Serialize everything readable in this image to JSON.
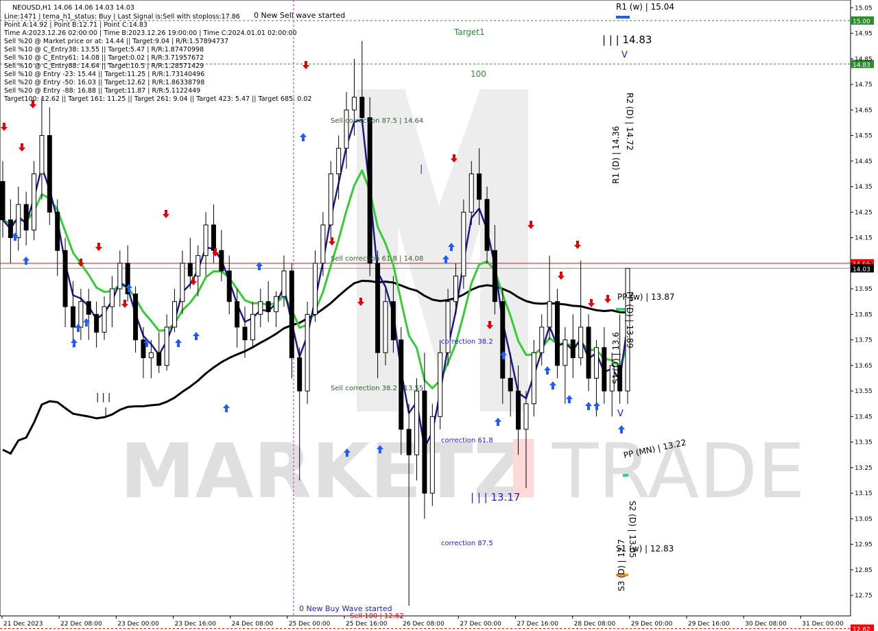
{
  "symbol_line": "NEOUSD,H1  14.06 14.06 14.03 14.03",
  "info_lines": [
    "Line:1471 | tema_h1_status: Buy | Last Signal is:Sell with stoploss:17.86",
    "Point A:14.92 | Point B:12.71 | Point C:14.83",
    "Time A:2023.12.26 02:00:00 | Time B:2023.12.26 19:00:00 | Time C:2024.01.01 02:00:00",
    "Sell %20 @ Market price or at: 14.44 || Target:9.04 | R/R:1.57894737",
    "Sell %10 @ C_Entry38: 13.55 || Target:5.47 | R/R:1.87470998",
    "Sell %10 @ C_Entry61: 14.08 || Target:0.02 | R/R:3.71957672",
    "Sell %10 @ C_Entry88: 14.64 || Target:10.5 | R/R:1.28571429",
    "Sell %10 @ Entry -23: 15.44 || Target:11.25 | R/R:1.73140496",
    "Sell %20 @ Entry -50: 16.03 || Target:12.62 | R/R:1.86338798",
    "Sell %20 @ Entry -88: 16.88 || Target:11.87 | R/R:5.1122449",
    "Target100: 12.62 || Target 161: 11.25 || Target 261: 9.04 || Target 423: 5.47 || Target 685: 0.02"
  ],
  "chart_labels": {
    "new_sell_wave": "0 New Sell wave started",
    "new_buy_wave": "0 New Buy Wave started",
    "target1": "Target1",
    "hundred": "100",
    "sell_corr_875": "Sell correction 87.5 | 14.64",
    "sell_corr_618": "Sell correction 61.8 | 14.08",
    "sell_corr_382": "Sell correction 38.2 | 13.55",
    "corr_382": "correction 38.2",
    "corr_618": "correction 61.8",
    "corr_875": "correction 87.5",
    "wave_1483": "| | | 14.83",
    "wave_1317": "| | | 13.17",
    "sell_100": "Sell 100 | 12.62",
    "r1w": "R1 (w) | 15.04",
    "r2d": "R2 (D) | 14.72",
    "r1d": "R1 (D) | 14.36",
    "ppw": "PP (w) | 13.87",
    "ppd": "PP (D) | 13.89",
    "s1d": "S1 (D) | 13.6",
    "ppmn": "PP (MN) | 13.22",
    "s2d": "S2 (D) | 13.05",
    "s1w": "S1 (w) | 12.83",
    "s3d": "S3 (D) | 12.7",
    "mark_bars": "| | |",
    "mark_bar": "|",
    "mark_v": "V"
  },
  "watermark": {
    "left": "MARKETZ",
    "right": "TRADE"
  },
  "colors": {
    "bullish": "#000000",
    "ma_blue": "#1a1a8c",
    "ma_green": "#33cc33",
    "ma_black": "#000000",
    "buy_arrow": "#1e5cff",
    "sell_arrow": "#e00000",
    "price_line": "#ff0000",
    "level_green": "#2e8b2e",
    "magenta": "#d020c0",
    "axis_bg_red": "#ff0000",
    "axis_bg_green": "#2e8b2e"
  },
  "chart_data": {
    "type": "candlestick",
    "ylim": [
      12.675,
      15.075
    ],
    "y_ticks": [
      "15.05",
      "14.95",
      "14.85",
      "14.75",
      "14.65",
      "14.55",
      "14.45",
      "14.35",
      "14.25",
      "14.15",
      "14.05",
      "13.95",
      "13.85",
      "13.75",
      "13.65",
      "13.55",
      "13.45",
      "13.35",
      "13.25",
      "13.15",
      "13.05",
      "12.95",
      "12.85",
      "12.75"
    ],
    "x_ticks": [
      "21 Dec 2023",
      "22 Dec 08:00",
      "23 Dec 00:00",
      "23 Dec 16:00",
      "24 Dec 08:00",
      "25 Dec 00:00",
      "25 Dec 16:00",
      "26 Dec 08:00",
      "27 Dec 00:00",
      "27 Dec 16:00",
      "28 Dec 08:00",
      "29 Dec 00:00",
      "29 Dec 16:00",
      "30 Dec 08:00",
      "31 Dec 00:00"
    ],
    "current_price": 14.03,
    "current_price_label": "14.03",
    "bid_price": 14.05,
    "bid_price_label": "14.05",
    "levels": [
      {
        "name": "Target1",
        "value": 15.0,
        "label": "15.00",
        "color": "#2e8b2e"
      },
      {
        "name": "100",
        "value": 14.83,
        "label": "14.83",
        "color": "#2e8b2e"
      },
      {
        "name": "Sell 100",
        "value": 12.62,
        "label": "12.62",
        "color": "#ff0000"
      }
    ],
    "pivots": [
      {
        "name": "R1 (w)",
        "value": 15.04,
        "color": "#1e5cff"
      },
      {
        "name": "PP (w)",
        "value": 13.87,
        "color": "#22dd77"
      },
      {
        "name": "PP (MN)",
        "value": 13.22,
        "color": "#22dd77"
      },
      {
        "name": "S1 (w)",
        "value": 12.83,
        "color": "#ff9900"
      }
    ],
    "candles": [
      [
        14.37,
        14.45,
        14.15,
        14.22
      ],
      [
        14.22,
        14.3,
        14.05,
        14.15
      ],
      [
        14.15,
        14.35,
        14.1,
        14.28
      ],
      [
        14.28,
        14.33,
        14.12,
        14.18
      ],
      [
        14.18,
        14.45,
        14.14,
        14.4
      ],
      [
        14.4,
        14.7,
        14.3,
        14.55
      ],
      [
        14.55,
        14.66,
        14.2,
        14.25
      ],
      [
        14.25,
        14.3,
        14.0,
        14.1
      ],
      [
        14.1,
        14.15,
        13.8,
        13.88
      ],
      [
        13.88,
        13.98,
        13.72,
        13.8
      ],
      [
        13.8,
        13.95,
        13.75,
        13.9
      ],
      [
        13.9,
        13.95,
        13.75,
        13.85
      ],
      [
        13.85,
        13.9,
        13.72,
        13.78
      ],
      [
        13.78,
        13.92,
        13.75,
        13.88
      ],
      [
        13.88,
        14.0,
        13.8,
        13.95
      ],
      [
        13.95,
        14.1,
        13.88,
        14.05
      ],
      [
        14.05,
        14.12,
        13.9,
        13.93
      ],
      [
        13.93,
        13.96,
        13.7,
        13.75
      ],
      [
        13.75,
        13.8,
        13.6,
        13.68
      ],
      [
        13.68,
        13.75,
        13.6,
        13.7
      ],
      [
        13.7,
        13.78,
        13.62,
        13.65
      ],
      [
        13.65,
        13.85,
        13.63,
        13.8
      ],
      [
        13.8,
        13.95,
        13.78,
        13.9
      ],
      [
        13.9,
        14.1,
        13.85,
        14.05
      ],
      [
        14.05,
        14.15,
        13.95,
        14.0
      ],
      [
        14.0,
        14.12,
        13.92,
        14.08
      ],
      [
        14.08,
        14.25,
        14.0,
        14.2
      ],
      [
        14.2,
        14.28,
        14.05,
        14.1
      ],
      [
        14.1,
        14.18,
        13.98,
        14.02
      ],
      [
        14.02,
        14.08,
        13.85,
        13.9
      ],
      [
        13.9,
        13.95,
        13.72,
        13.8
      ],
      [
        13.8,
        13.88,
        13.68,
        13.75
      ],
      [
        13.75,
        13.9,
        13.72,
        13.85
      ],
      [
        13.85,
        13.95,
        13.8,
        13.9
      ],
      [
        13.9,
        13.98,
        13.82,
        13.86
      ],
      [
        13.86,
        13.94,
        13.8,
        13.92
      ],
      [
        13.92,
        14.08,
        13.88,
        14.02
      ],
      [
        14.02,
        14.05,
        13.6,
        13.68
      ],
      [
        13.68,
        13.72,
        13.2,
        13.55
      ],
      [
        13.55,
        13.9,
        13.5,
        13.85
      ],
      [
        13.85,
        14.1,
        13.82,
        14.05
      ],
      [
        14.05,
        14.25,
        14.0,
        14.2
      ],
      [
        14.2,
        14.45,
        14.15,
        14.4
      ],
      [
        14.4,
        14.55,
        14.3,
        14.5
      ],
      [
        14.5,
        14.72,
        14.42,
        14.65
      ],
      [
        14.65,
        14.85,
        14.55,
        14.7
      ],
      [
        14.7,
        14.92,
        14.6,
        14.62
      ],
      [
        14.62,
        14.7,
        14.0,
        14.05
      ],
      [
        14.05,
        14.1,
        13.6,
        13.7
      ],
      [
        13.7,
        13.95,
        13.65,
        13.9
      ],
      [
        13.9,
        14.0,
        13.7,
        13.75
      ],
      [
        13.75,
        13.8,
        13.3,
        13.4
      ],
      [
        13.4,
        13.5,
        12.71,
        13.3
      ],
      [
        13.3,
        13.6,
        13.2,
        13.55
      ],
      [
        13.55,
        13.7,
        13.05,
        13.15
      ],
      [
        13.15,
        13.5,
        13.1,
        13.45
      ],
      [
        13.45,
        13.75,
        13.4,
        13.7
      ],
      [
        13.7,
        13.95,
        13.65,
        13.9
      ],
      [
        13.9,
        14.05,
        13.85,
        14.0
      ],
      [
        14.0,
        14.3,
        13.95,
        14.25
      ],
      [
        14.25,
        14.45,
        14.2,
        14.4
      ],
      [
        14.4,
        14.5,
        14.2,
        14.3
      ],
      [
        14.3,
        14.35,
        14.05,
        14.1
      ],
      [
        14.1,
        14.2,
        13.85,
        13.9
      ],
      [
        13.9,
        13.95,
        13.5,
        13.6
      ],
      [
        13.6,
        13.7,
        13.45,
        13.55
      ],
      [
        13.55,
        13.65,
        13.3,
        13.4
      ],
      [
        13.4,
        13.55,
        13.17,
        13.5
      ],
      [
        13.5,
        13.75,
        13.45,
        13.7
      ],
      [
        13.7,
        13.85,
        13.65,
        13.8
      ],
      [
        13.8,
        14.08,
        13.75,
        13.9
      ],
      [
        13.9,
        13.95,
        13.6,
        13.65
      ],
      [
        13.65,
        13.8,
        13.5,
        13.75
      ],
      [
        13.75,
        13.85,
        13.6,
        13.68
      ],
      [
        13.68,
        14.06,
        13.65,
        13.8
      ],
      [
        13.8,
        13.85,
        13.55,
        13.6
      ],
      [
        13.6,
        13.75,
        13.45,
        13.72
      ],
      [
        13.72,
        13.8,
        13.5,
        13.55
      ],
      [
        13.55,
        13.7,
        13.45,
        13.65
      ],
      [
        13.65,
        13.85,
        13.5,
        13.55
      ],
      [
        13.55,
        13.95,
        13.5,
        14.03
      ]
    ]
  }
}
